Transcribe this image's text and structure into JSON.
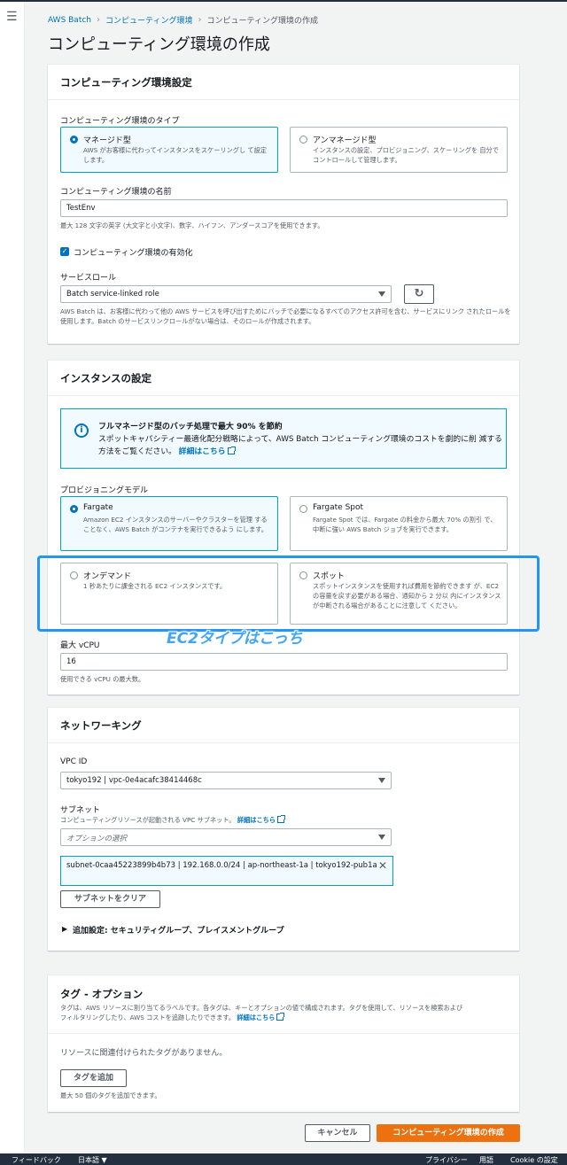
{
  "breadcrumb": {
    "root": "AWS Batch",
    "parent": "コンピューティング環境",
    "current": "コンピューティング環境の作成"
  },
  "page_title": "コンピューティング環境の作成",
  "env_config": {
    "heading": "コンピューティング環境設定",
    "type_label": "コンピューティング環境のタイプ",
    "managed": {
      "title": "マネージド型",
      "desc": "AWS がお客様に代わってインスタンスをスケーリングし て設定します。"
    },
    "unmanaged": {
      "title": "アンマネージド型",
      "desc": "インスタンスの設定、プロビジョニング、スケーリングを 自分でコントロールして管理します。"
    },
    "name_label": "コンピューティング環境の名前",
    "name_value": "TestEnv",
    "name_help": "最大 128 文字の英字 (大文字と小文字)、数字、ハイフン、アンダースコアを使用できます。",
    "enable_label": "コンピューティング環境の有効化",
    "role_label": "サービスロール",
    "role_value": "Batch service-linked role",
    "role_help": "AWS Batch は、お客様に代わって他の AWS サービスを呼び出すためにバッチで必要になるすべてのアクセス許可を含む、サービスにリンク されたロールを使用します。Batch のサービスリンクロールがない場合は、そのロールが作成されます。"
  },
  "instance": {
    "heading": "インスタンスの設定",
    "info_title": "フルマネージド型のバッチ処理で最大 90% を節約",
    "info_body": "スポットキャパシティー最適化配分戦略によって、AWS Batch コンピューティング環境のコストを劇的に削 減する方法をご覧ください。",
    "info_link": "詳細はこちら",
    "model_label": "プロビジョニングモデル",
    "fargate": {
      "title": "Fargate",
      "desc": "Amazon EC2 インスタンスのサーバーやクラスターを管理 することなく、AWS Batch がコンテナを実行できるよう にします。"
    },
    "fargate_spot": {
      "title": "Fargate Spot",
      "desc": "Fargate Spot では、Fargate の料金から最大 70% の割引 で、中断に強い AWS Batch ジョブを実行できます。"
    },
    "ondemand": {
      "title": "オンデマンド",
      "desc": "1 秒あたりに課金される EC2 インスタンスです。"
    },
    "spot": {
      "title": "スポット",
      "desc": "スポットインスタンスを使用すれば費用を節約できます が、EC2 の容量を戻す必要がある場合、通知から 2 分以 内にインスタンスが中断される場合があることに注意して ください。"
    },
    "annotation": "EC2タイプはこっち",
    "vcpu_label": "最大 vCPU",
    "vcpu_value": "16",
    "vcpu_help": "使用できる vCPU の最大数。"
  },
  "networking": {
    "heading": "ネットワーキング",
    "vpc_label": "VPC ID",
    "vpc_value": "tokyo192 | vpc-0e4acafc38414468c",
    "subnet_label": "サブネット",
    "subnet_help": "コンピューティングリソースが起動される VPC サブネット。",
    "subnet_link": "詳細はこちら",
    "subnet_placeholder": "オプションの選択",
    "subnet_token": "subnet-0caa45223899b4b73 | 192.168.0.0/24 | ap-northeast-1a | tokyo192-pub1a",
    "clear_button": "サブネットをクリア",
    "additional": "追加設定: セキュリティグループ、プレイスメントグループ"
  },
  "tags": {
    "heading": "タグ - オプション",
    "desc1": "タグは、AWS リソースに割り当てるラベルです。各タグは、キーとオプションの値で構成されます。タグを使用して、リソースを検索および",
    "desc2": "フィルタリングしたり、AWS コストを追跡したりできます。",
    "link": "詳細はこちら",
    "empty": "リソースに関連付けられたタグがありません。",
    "add_button": "タグを追加",
    "limit": "最大 50 個のタグを追加できます。"
  },
  "actions": {
    "cancel": "キャンセル",
    "create": "コンピューティング環境の作成"
  },
  "footer": {
    "feedback": "フィードバック",
    "language": "日本語 ▼",
    "privacy": "プライバシー",
    "terms": "用語",
    "cookie": "Cookie の設定"
  },
  "colors": {
    "accent": "#0073bb",
    "primary": "#ec7211",
    "annotation": "#2196f3"
  }
}
